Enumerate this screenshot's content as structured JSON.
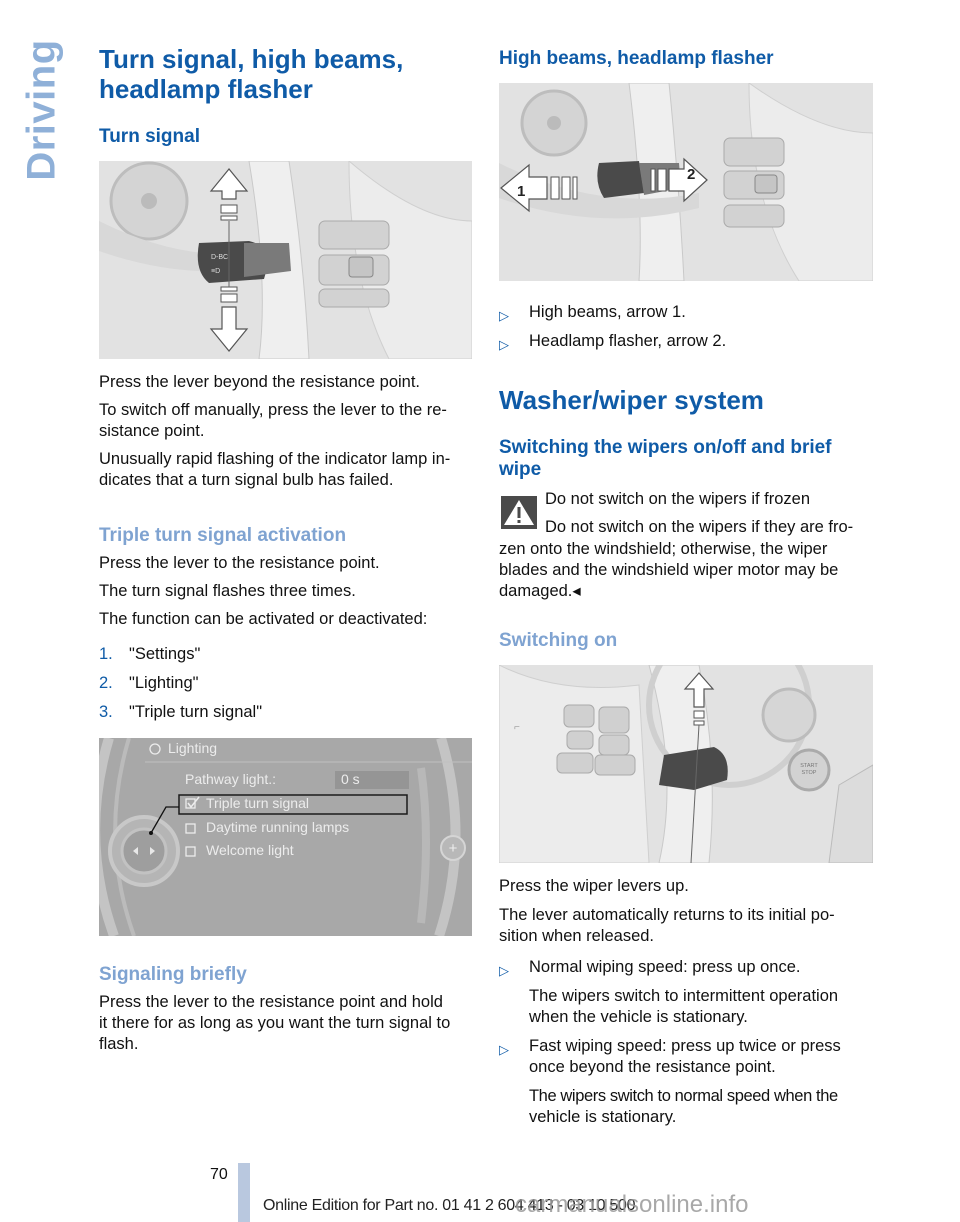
{
  "side_tab": {
    "label": "Driving"
  },
  "left": {
    "title": "Turn signal, high beams, headlamp flasher",
    "title_line1": "Turn signal, high beams,",
    "title_line2": "headlamp flasher",
    "turn_signal": {
      "heading": "Turn signal",
      "para1": "Press the lever beyond the resistance point.",
      "para2_line1": "To switch off manually, press the lever to the re-",
      "para2_line2": "sistance point.",
      "para3_line1": "Unusually rapid flashing of the indicator lamp in-",
      "para3_line2": "dicates that a turn signal bulb has failed."
    },
    "triple": {
      "heading": "Triple turn signal activation",
      "para1": "Press the lever to the resistance point.",
      "para2": "The turn signal flashes three times.",
      "para3": "The function can be activated or deactivated:",
      "steps": [
        {
          "num": "1.",
          "text": "\"Settings\""
        },
        {
          "num": "2.",
          "text": "\"Lighting\""
        },
        {
          "num": "3.",
          "text": "\"Triple turn signal\""
        }
      ]
    },
    "screen": {
      "title": "Lighting",
      "pathway_label": "Pathway light.:",
      "pathway_value": "0 s",
      "options": [
        {
          "label": "Triple turn signal",
          "checked": true,
          "selected": true
        },
        {
          "label": "Daytime running lamps",
          "checked": false,
          "selected": false
        },
        {
          "label": "Welcome light",
          "checked": false,
          "selected": false
        }
      ]
    },
    "signaling": {
      "heading": "Signaling briefly",
      "line1": "Press the lever to the resistance point and hold",
      "line2": "it there for as long as you want the turn signal to",
      "line3": "flash."
    }
  },
  "right": {
    "high_beams": {
      "heading": "High beams, headlamp flasher",
      "arrow1_label": "1",
      "arrow2_label": "2",
      "bullets": [
        "High beams, arrow 1.",
        "Headlamp flasher, arrow 2."
      ]
    },
    "washer": {
      "title": "Washer/wiper system",
      "sub_line1": "Switching the wipers on/off and brief",
      "sub_line2": "wipe",
      "warning": {
        "title": "Do not switch on the wipers if frozen",
        "line1": "Do not switch on the wipers if they are fro-",
        "line2": "zen onto the windshield; otherwise, the wiper",
        "line3": "blades and the windshield wiper motor may be",
        "line4": "damaged.◂"
      },
      "switching_on": {
        "heading": "Switching on",
        "start_button": "START STOP ENGINE",
        "para1": "Press the wiper levers up.",
        "para2_line1": "The lever automatically returns to its initial po-",
        "para2_line2": "sition when released.",
        "bullets": [
          {
            "line1": "Normal wiping speed: press up once.",
            "sub1": "The wipers switch to intermittent operation",
            "sub2": "when the vehicle is stationary."
          },
          {
            "line1": "Fast wiping speed: press up twice or press",
            "line2": "once beyond the resistance point.",
            "sub1": "The wipers switch to normal speed when the",
            "sub2": "vehicle is stationary."
          }
        ]
      }
    }
  },
  "footer": {
    "page_number": "70",
    "edition": "Online Edition for Part no. 01 41 2 604 413 - 03 10 500",
    "watermark": "carmanualsonline.info"
  },
  "colors": {
    "heading_blue": "#0f5ba7",
    "subheading_light_blue": "#7fa3d1",
    "side_tab": "#8fb0d8",
    "footer_bar": "#b9c8df"
  }
}
